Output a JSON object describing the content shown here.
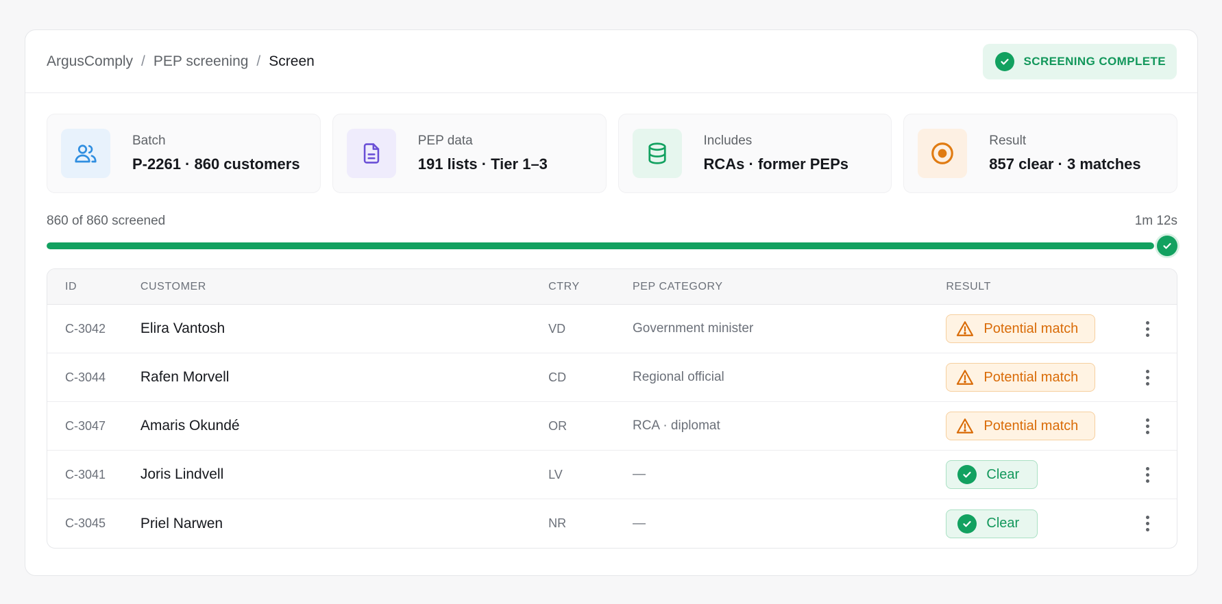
{
  "breadcrumb": {
    "app": "ArgusComply",
    "section": "PEP screening",
    "current": "Screen",
    "separator": "/"
  },
  "status": {
    "label": "SCREENING COMPLETE",
    "icon": "check-circle-icon",
    "color": "#12a160"
  },
  "stats": [
    {
      "label": "Batch",
      "value": "P-2261 · 860 customers",
      "icon": "users-icon",
      "color": "#2f8ee0",
      "bg": "#e8f2fc"
    },
    {
      "label": "PEP data",
      "value": "191 lists · Tier 1–3",
      "icon": "document-icon",
      "color": "#6a4fd6",
      "bg": "#efecfc"
    },
    {
      "label": "Includes",
      "value": "RCAs · former PEPs",
      "icon": "database-icon",
      "color": "#12a160",
      "bg": "#e6f6ee"
    },
    {
      "label": "Result",
      "value": "857 clear · 3 matches",
      "icon": "target-icon",
      "color": "#e07b12",
      "bg": "#fdf0e3"
    }
  ],
  "progress": {
    "label": "860 of 860 screened",
    "elapsed": "1m 12s",
    "percent": 100
  },
  "table": {
    "columns": {
      "id": "ID",
      "customer": "CUSTOMER",
      "ctry": "CTRY",
      "category": "PEP CATEGORY",
      "result": "RESULT"
    },
    "rows": [
      {
        "id": "C-3042",
        "customer": "Elira Vantosh",
        "ctry": "VD",
        "category": "Government minister",
        "result": "Potential match",
        "status": "warn"
      },
      {
        "id": "C-3044",
        "customer": "Rafen Morvell",
        "ctry": "CD",
        "category": "Regional official",
        "result": "Potential match",
        "status": "warn"
      },
      {
        "id": "C-3047",
        "customer": "Amaris Okundé",
        "ctry": "OR",
        "category": "RCA · diplomat",
        "result": "Potential match",
        "status": "warn"
      },
      {
        "id": "C-3041",
        "customer": "Joris Lindvell",
        "ctry": "LV",
        "category": "—",
        "result": "Clear",
        "status": "ok"
      },
      {
        "id": "C-3045",
        "customer": "Priel Narwen",
        "ctry": "NR",
        "category": "—",
        "result": "Clear",
        "status": "ok"
      }
    ]
  },
  "colors": {
    "success": "#12a160",
    "warning": "#d96b07"
  }
}
